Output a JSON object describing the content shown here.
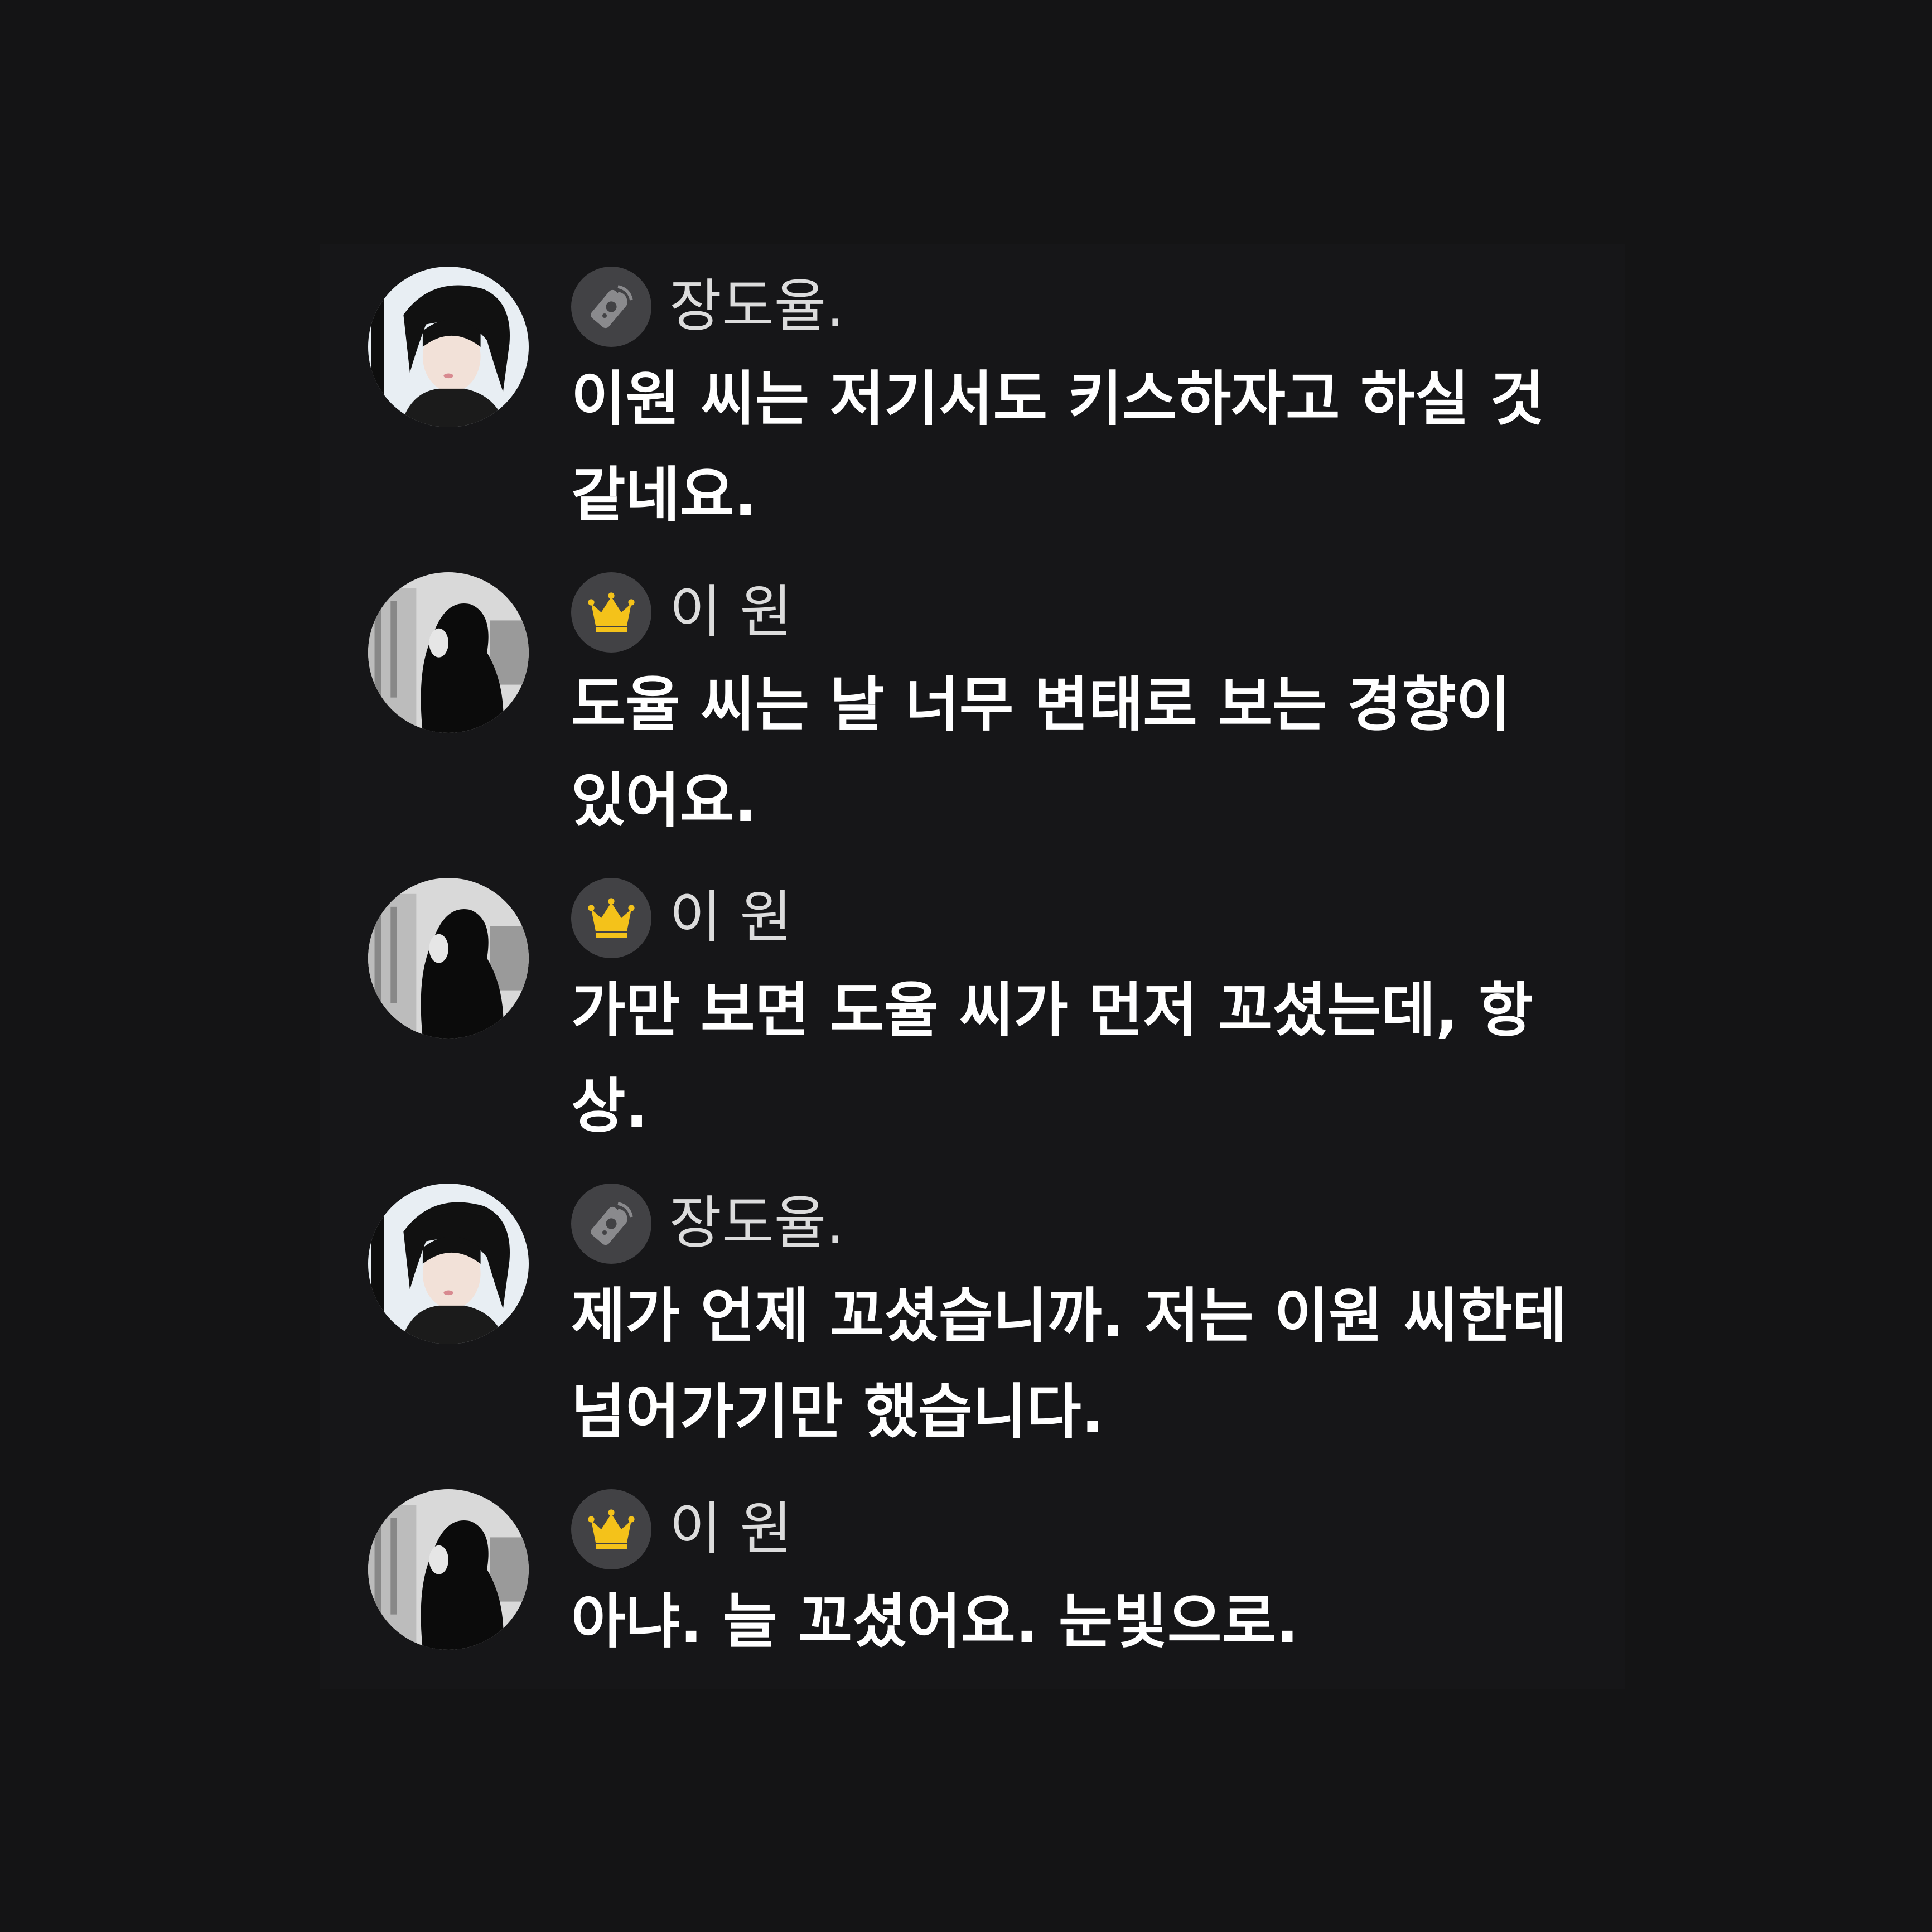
{
  "messages": [
    {
      "author": "장도율.",
      "badge_icon": "phone-remote-icon",
      "avatar_icon": "male-profile-avatar",
      "text": "이원 씨는 저기서도 키스하자고 하실 것 같네요."
    },
    {
      "author": "이 원",
      "badge_icon": "crown-icon",
      "avatar_icon": "female-profile-avatar",
      "text": "도율 씨는 날 너무 변태로 보는 경향이 있어요."
    },
    {
      "author": "이 원",
      "badge_icon": "crown-icon",
      "avatar_icon": "female-profile-avatar",
      "text": "가만 보면 도율 씨가 먼저 꼬셨는데, 항상."
    },
    {
      "author": "장도율.",
      "badge_icon": "phone-remote-icon",
      "avatar_icon": "male-profile-avatar",
      "text": "제가 언제 꼬셨습니까. 저는 이원 씨한테 넘어가기만 했습니다."
    },
    {
      "author": "이 원",
      "badge_icon": "crown-icon",
      "avatar_icon": "female-profile-avatar",
      "text": "아냐. 늘 꼬셨어요. 눈빛으로."
    }
  ],
  "colors": {
    "background": "#141415",
    "panel": "#161618",
    "badge_bg": "#424245",
    "crown": "#f4c21a",
    "name_text": "#dcdcdc",
    "message_text": "#ffffff"
  }
}
